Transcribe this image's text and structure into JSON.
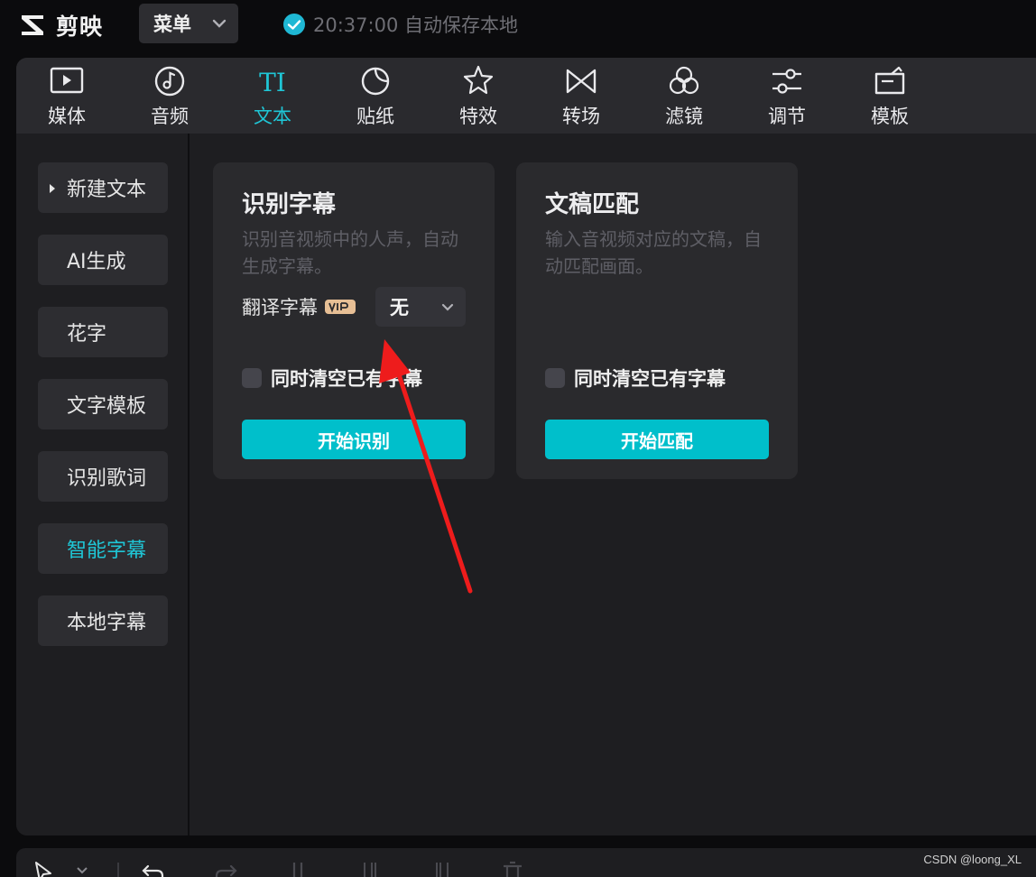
{
  "app": {
    "brand": "剪映",
    "menu_label": "菜单",
    "save_status": "20:37:00 自动保存本地"
  },
  "toolbar": {
    "items": [
      {
        "label": "媒体",
        "icon": "media-play-icon"
      },
      {
        "label": "音频",
        "icon": "audio-note-icon"
      },
      {
        "label": "文本",
        "icon": "text-ti-icon",
        "glyph": "TI",
        "active": true
      },
      {
        "label": "贴纸",
        "icon": "sticker-icon"
      },
      {
        "label": "特效",
        "icon": "effects-star-icon"
      },
      {
        "label": "转场",
        "icon": "transition-bowtie-icon"
      },
      {
        "label": "滤镜",
        "icon": "filter-circles-icon"
      },
      {
        "label": "调节",
        "icon": "adjust-sliders-icon"
      },
      {
        "label": "模板",
        "icon": "template-icon"
      }
    ]
  },
  "sidebar": {
    "items": [
      {
        "label": "新建文本"
      },
      {
        "label": "AI生成"
      },
      {
        "label": "花字"
      },
      {
        "label": "文字模板"
      },
      {
        "label": "识别歌词"
      },
      {
        "label": "智能字幕",
        "active": true
      },
      {
        "label": "本地字幕"
      }
    ]
  },
  "cards": {
    "recognize": {
      "title": "识别字幕",
      "description": "识别音视频中的人声，自动生成字幕。",
      "translate_label": "翻译字幕",
      "translate_value": "无",
      "clear_label": "同时清空已有字幕",
      "button_label": "开始识别"
    },
    "match": {
      "title": "文稿匹配",
      "description": "输入音视频对应的文稿，自动匹配画面。",
      "clear_label": "同时清空已有字幕",
      "button_label": "开始匹配"
    }
  },
  "watermark": "CSDN @loong_XL",
  "colors": {
    "accent": "#1fc6d6",
    "button": "#00bfcb",
    "annotation_arrow": "#ee1c1c"
  }
}
